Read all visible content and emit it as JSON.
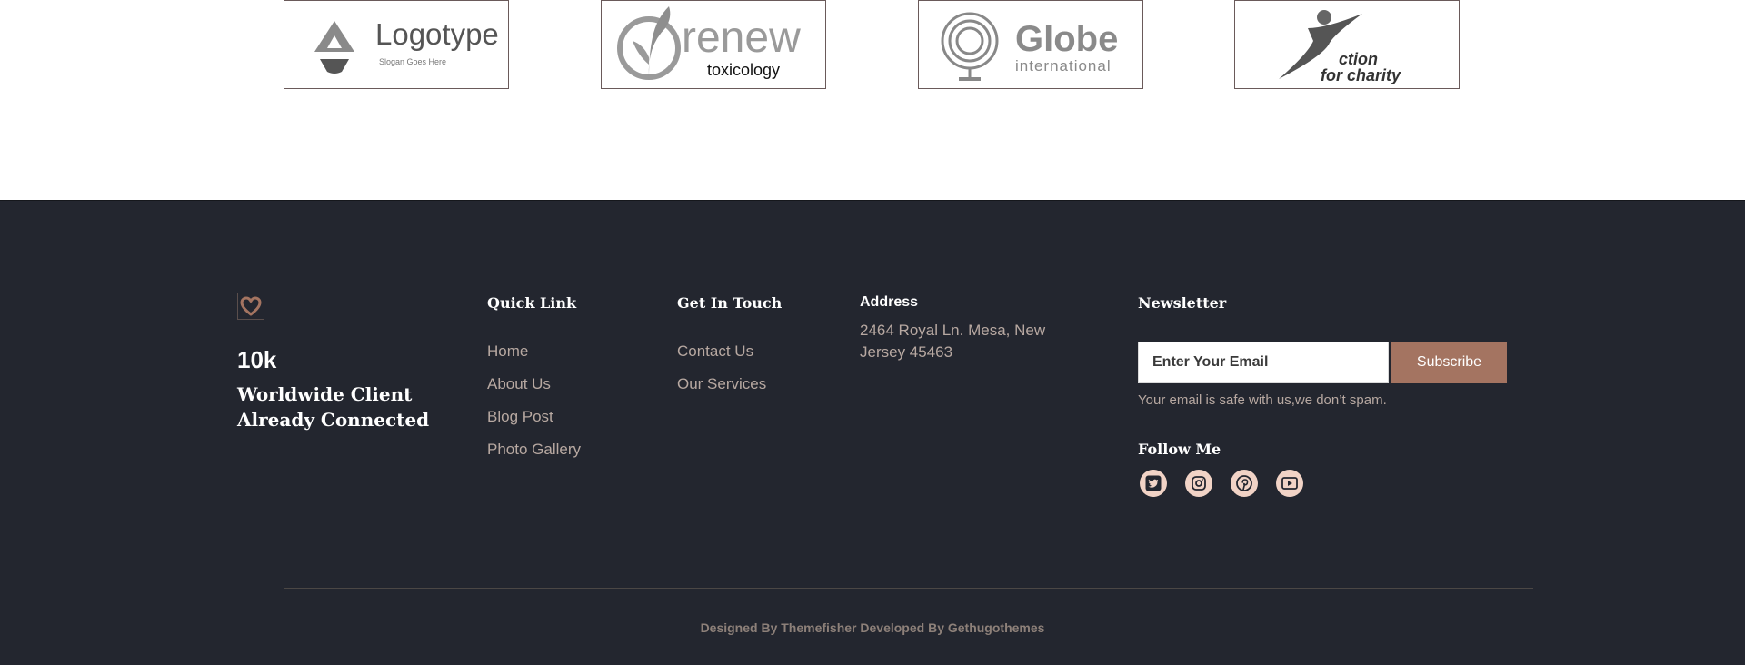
{
  "logos": [
    {
      "name": "Logotype",
      "slogan": "Slogan Goes Here"
    },
    {
      "name": "renew",
      "sub": "toxicology"
    },
    {
      "name": "Globe",
      "sub": "international"
    },
    {
      "name": "ction",
      "sub": "for charity"
    }
  ],
  "footer": {
    "stat_number": "10k",
    "stat_text": "Worldwide Client Already Connected",
    "quick_link": {
      "title": "Quick Link",
      "items": [
        "Home",
        "About Us",
        "Blog Post",
        "Photo Gallery"
      ]
    },
    "get_in_touch": {
      "title": "Get In Touch",
      "items": [
        "Contact Us",
        "Our Services"
      ]
    },
    "address": {
      "title": "Address",
      "text": "2464 Royal Ln. Mesa, New Jersey 45463"
    },
    "newsletter": {
      "title": "Newsletter",
      "placeholder": "Enter Your Email",
      "button": "Subscribe",
      "note": "Your email is safe with us,we don’t spam."
    },
    "follow": {
      "title": "Follow Me",
      "icons": [
        "twitter-icon",
        "instagram-icon",
        "pinterest-icon",
        "youtube-icon"
      ]
    },
    "credits": "Designed By Themefisher Developed By Gethugothemes"
  },
  "colors": {
    "footer_bg": "#23262f",
    "accent": "#a47461",
    "link": "#b7a8a1",
    "social_bg": "#f1d3c6"
  }
}
